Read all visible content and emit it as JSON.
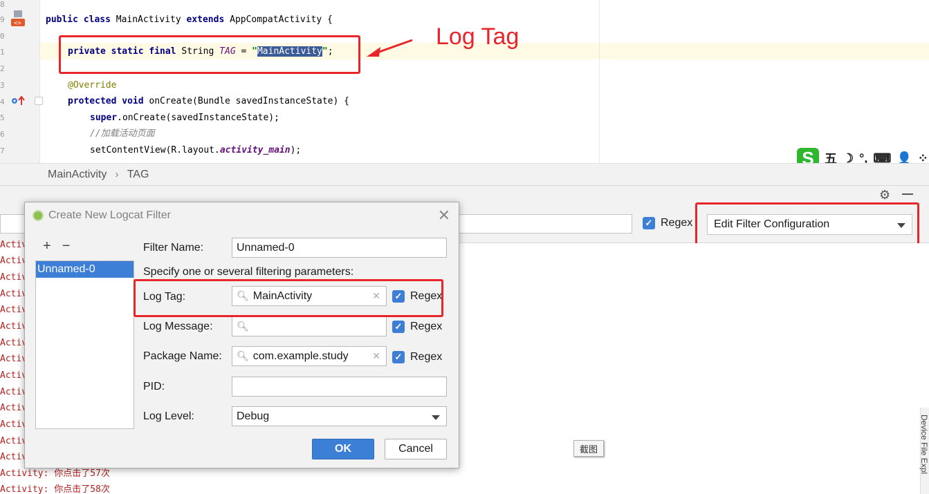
{
  "editor": {
    "line_numbers": [
      "8",
      "9",
      "0",
      "1",
      "2",
      "3",
      "4",
      "5",
      "6",
      "7"
    ],
    "lines": {
      "class_decl": {
        "kw1": "public class ",
        "name": "MainActivity ",
        "kw2": "extends ",
        "rest": "AppCompatActivity {"
      },
      "tag_decl": {
        "kw": "private static final ",
        "type": "String ",
        "field": "TAG",
        "eq": " = ",
        "q1": "\"",
        "value": "MainActivity",
        "q2": "\"",
        "semi": ";"
      },
      "override": "@Override",
      "oncreate": {
        "kw": "protected void ",
        "rest": "onCreate(Bundle savedInstanceState) {"
      },
      "super_call": {
        "kw": "super",
        "rest": ".onCreate(savedInstanceState);"
      },
      "comment": "//加载活动页面",
      "setcontent": {
        "pre": "setContentView(R.layout.",
        "field": "activity_main",
        "post": ");"
      }
    }
  },
  "annotation": {
    "callout": "Log Tag"
  },
  "ime": {
    "s": "S",
    "chars": [
      "五",
      "☽",
      "°,",
      "⌨",
      "👤",
      "⁘"
    ]
  },
  "breadcrumb": {
    "class": "MainActivity",
    "separator": "›",
    "member": "TAG"
  },
  "logcat": {
    "regex_label": "Regex",
    "filter_select": "Edit Filter Configuration",
    "truncated_lines": [
      "Activ",
      "Activ",
      "Activ",
      "Activ",
      "Activ",
      "Activ",
      "Activ",
      "Activ",
      "Activ",
      "Activ",
      "Activ",
      "Activ",
      "Activ",
      "Activ"
    ],
    "full_lines": [
      "Activity: 你点击了57次",
      "Activity: 你点击了58次"
    ],
    "side_tab": "Device File Expl",
    "screenshot_btn": "截图"
  },
  "dialog": {
    "title": "Create New Logcat Filter",
    "add": "+",
    "remove": "−",
    "list_items": [
      "Unnamed-0"
    ],
    "filter_name_label": "Filter Name:",
    "filter_name_value": "Unnamed-0",
    "params_hint": "Specify one or several filtering parameters:",
    "log_tag_label": "Log Tag:",
    "log_tag_value": "MainActivity",
    "log_message_label": "Log Message:",
    "log_message_value": "",
    "package_label": "Package Name:",
    "package_value": "com.example.study",
    "pid_label": "PID:",
    "pid_value": "",
    "log_level_label": "Log Level:",
    "log_level_value": "Debug",
    "regex_label": "Regex",
    "ok": "OK",
    "cancel": "Cancel"
  }
}
